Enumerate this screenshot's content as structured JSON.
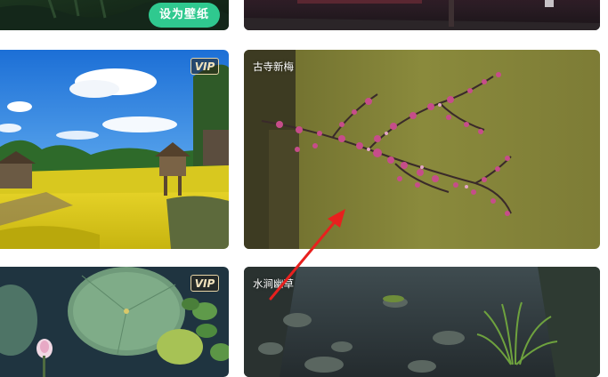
{
  "gallery": {
    "top_left_card": {
      "set_wallpaper_label": "设为壁纸"
    },
    "cards": [
      {
        "title": "",
        "vip_label": "VIP"
      },
      {
        "title": "古寺新梅"
      },
      {
        "title": "",
        "vip_label": "VIP"
      },
      {
        "title": "水涧幽草"
      }
    ]
  },
  "overlay": {
    "arrow_color": "#e8201e"
  }
}
